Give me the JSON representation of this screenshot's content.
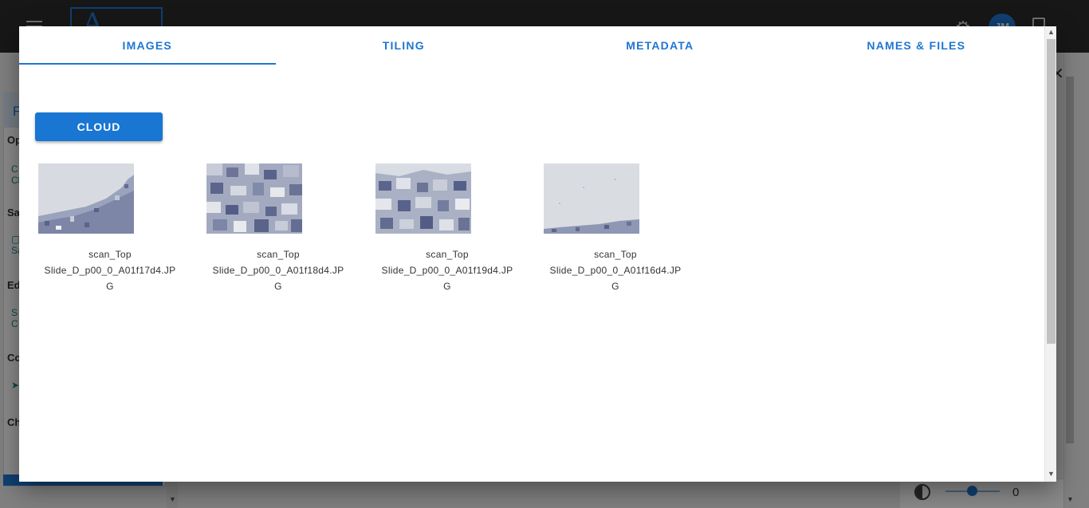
{
  "dialog": {
    "tabs": [
      {
        "label": "IMAGES",
        "active": true
      },
      {
        "label": "TILING",
        "active": false
      },
      {
        "label": "METADATA",
        "active": false
      },
      {
        "label": "NAMES & FILES",
        "active": false
      }
    ],
    "cloud_button": "CLOUD",
    "images": [
      {
        "line1": "scan_Top",
        "line2": "Slide_D_p00_0_A01f17d4.JP",
        "line3": "G"
      },
      {
        "line1": "scan_Top",
        "line2": "Slide_D_p00_0_A01f18d4.JP",
        "line3": "G"
      },
      {
        "line1": "scan_Top",
        "line2": "Slide_D_p00_0_A01f19d4.JP",
        "line3": "G"
      },
      {
        "line1": "scan_Top",
        "line2": "Slide_D_p00_0_A01f16d4.JP",
        "line3": "G"
      }
    ]
  },
  "background": {
    "avatar_initials": "JM",
    "contrast_value": "0",
    "accent_color": "#1976d2"
  }
}
